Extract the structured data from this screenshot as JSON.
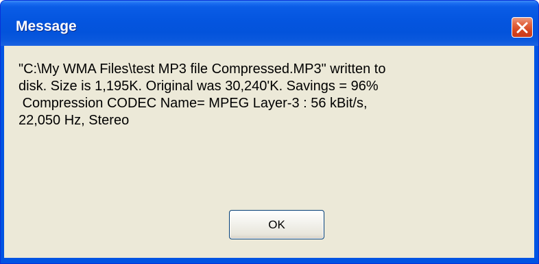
{
  "dialog": {
    "title": "Message",
    "close_icon": "close-icon",
    "message": "\"C:\\My WMA Files\\test MP3 file Compressed.MP3\" written to\ndisk. Size is 1,195K. Original was 30,240'K. Savings = 96%\n Compression CODEC Name= MPEG Layer-3 : 56 kBit/s,\n22,050 Hz, Stereo",
    "ok_label": "OK"
  },
  "colors": {
    "titlebar": "#0054e3",
    "close_button": "#d4431c",
    "client_background": "#ece9d8"
  }
}
